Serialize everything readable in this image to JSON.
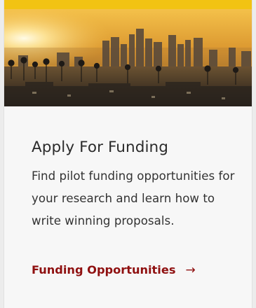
{
  "card": {
    "title": "Apply For Funding",
    "description": "Find pilot funding opportunities for your research and learn how to write winning proposals.",
    "link_label": "Funding Opportunities",
    "link_arrow": "→",
    "hero_image": "los-angeles-skyline-sunset-photo"
  },
  "colors": {
    "accent": "#f2c313",
    "link": "#8f1010",
    "text": "#2b2b2b"
  }
}
